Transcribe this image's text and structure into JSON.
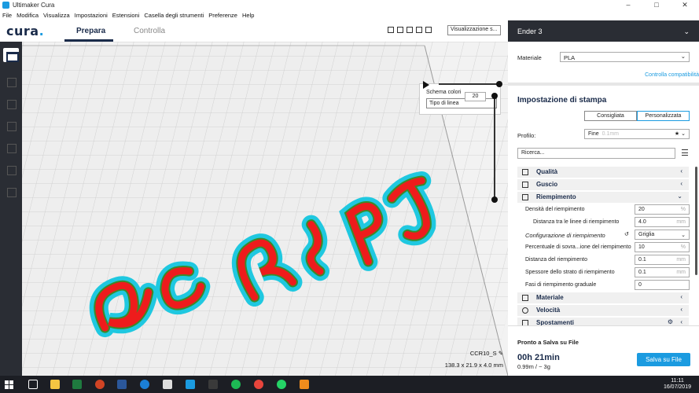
{
  "window": {
    "title": "Ultimaker Cura",
    "controls": [
      "–",
      "□",
      "✕"
    ]
  },
  "menu": [
    "File",
    "Modifica",
    "Visualizza",
    "Impostazioni",
    "Estensioni",
    "Casella degli strumenti",
    "Preferenze",
    "Help"
  ],
  "header": {
    "logo": "cura",
    "logo_dot": ".",
    "stages": {
      "prepare": "Prepara",
      "monitor": "Controlla"
    },
    "view_select": "Visualizzazione s..."
  },
  "color_panel": {
    "label": "Schema colori",
    "value": "Tipo di linea"
  },
  "layer_view": {
    "layer": "20"
  },
  "model": {
    "name": "CCR10_S",
    "dimensions": "138.3 x 21.9 x 4.0 mm"
  },
  "sidebar": {
    "printer": "Ender 3",
    "material_label": "Materiale",
    "material_value": "PLA",
    "compat_link": "Controlla compatibilità",
    "print_setup_title": "Impostazione di stampa",
    "mode_recommended": "Consigliata",
    "mode_custom": "Personalizzata",
    "profile_label": "Profilo:",
    "profile_value": "Fine",
    "profile_sub": "0.1mm",
    "search_placeholder": "Ricerca...",
    "categories": {
      "quality": "Qualità",
      "shell": "Guscio",
      "infill": "Riempimento",
      "material": "Materiale",
      "speed": "Velocità",
      "travel": "Spostamenti"
    },
    "settings": [
      {
        "label": "Densità del riempimento",
        "value": "20",
        "unit": "%"
      },
      {
        "label": "Distanza tra le linee di riempimento",
        "value": "4.0",
        "unit": "mm"
      },
      {
        "label": "Configurazione di riempimento",
        "value": "Griglia",
        "unit": ""
      },
      {
        "label": "Percentuale di sovra...ione del riempimento",
        "value": "10",
        "unit": "%"
      },
      {
        "label": "Distanza del riempimento",
        "value": "0.1",
        "unit": "mm"
      },
      {
        "label": "Spessore dello strato di riempimento",
        "value": "0.1",
        "unit": "mm"
      },
      {
        "label": "Fasi di riempimento graduale",
        "value": "0",
        "unit": ""
      }
    ],
    "save": {
      "ready": "Pronto a Salva su File",
      "time": "00h 21min",
      "material_usage": "0.99m / ~ 3g",
      "button": "Salva su File"
    }
  },
  "taskbar": {
    "time": "11:11",
    "date": "16/07/2019"
  },
  "colors": {
    "accent": "#1b9be0",
    "dark": "#2a2d34",
    "model_red": "#ee1c1c",
    "model_green": "#3a8b2a",
    "model_cyan": "#1fc8e0"
  }
}
